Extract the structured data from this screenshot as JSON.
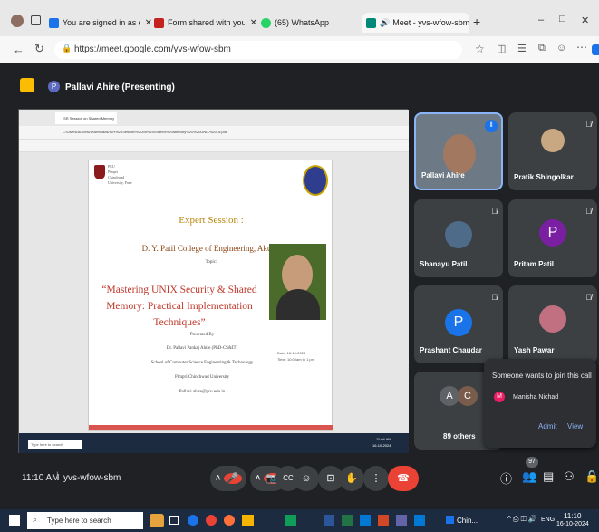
{
  "browser": {
    "tabs": [
      {
        "label": "You are signed in as dipalimpatil",
        "color": "#1a73e8"
      },
      {
        "label": "Form shared with you: \"ISR Class",
        "color": "#c5221f"
      },
      {
        "label": "(65) WhatsApp",
        "color": "#25d366"
      },
      {
        "label": "Meet - yvs-wfow-sbm",
        "color": "#00897b"
      }
    ],
    "new_tab": "+",
    "url": "https://meet.google.com/yvs-wfow-sbm",
    "window_controls": [
      "–",
      "□",
      "✕"
    ]
  },
  "meet": {
    "presenter_label": "Pallavi Ahire (Presenting)",
    "presenter_initial": "P",
    "time": "11:10 AM",
    "meeting_code": "yvs-wfow-sbm",
    "participant_count": "97",
    "controls": [
      "mic",
      "camera",
      "captions",
      "emoji",
      "present",
      "hand",
      "more",
      "leave"
    ]
  },
  "shared_screen": {
    "tab_title": "ISR Session on Shared Memory",
    "path": "C:/Users/ADMIN/Downloads/ISR%20Session%20on%20Shared%20Memory%20%20UNIX%20Ld.pdf",
    "slide": {
      "logo_text": [
        "PCU",
        "Pimpri",
        "Chinchwad",
        "University, Pune"
      ],
      "heading": "Expert Session :",
      "college": "D. Y. Patil College of Engineering, Akurdi",
      "topic_label": "Topic:",
      "title": "“Mastering UNIX Security & Shared Memory: Practical Implementation Techniques”",
      "presented_by": "Presented By",
      "speaker": "Dr. Pallavi Pankaj Ahire (PhD-CS&IT)",
      "school": "School of Computer Science Engineering & Technology",
      "university": "Pimpri Chinchwad University",
      "email": "Pallavi.ahire@pcu.edu.in",
      "date": "Date: 16-10-2024",
      "time": "Time: 10:00am to 1 pm"
    },
    "inner_taskbar": {
      "search": "Type here to search",
      "time": "11:04 AM",
      "date": "16-10-2024"
    }
  },
  "participants": [
    {
      "name": "Pallavi Ahire",
      "type": "video"
    },
    {
      "name": "Pratik Shingolkar",
      "type": "photo"
    },
    {
      "name": "Shanayu Patil",
      "type": "photo"
    },
    {
      "name": "Pritam Patil",
      "type": "letter",
      "initial": "P",
      "color": "#7b1fa2"
    },
    {
      "name": "Prashant Chaudar",
      "type": "letter",
      "initial": "P",
      "color": "#1a73e8"
    },
    {
      "name": "Yash Pawar",
      "type": "photo"
    },
    {
      "name": "89 others",
      "type": "others",
      "initials": [
        "A",
        "C"
      ]
    }
  ],
  "join_popup": {
    "title": "Someone wants to join this call",
    "name": "Manisha Nichad",
    "initial": "M",
    "admit": "Admit",
    "view": "View"
  },
  "taskbar": {
    "search": "Type here to search",
    "chin": "Chin...",
    "lang": "ENG",
    "time": "11:10",
    "date": "16-10-2024"
  }
}
